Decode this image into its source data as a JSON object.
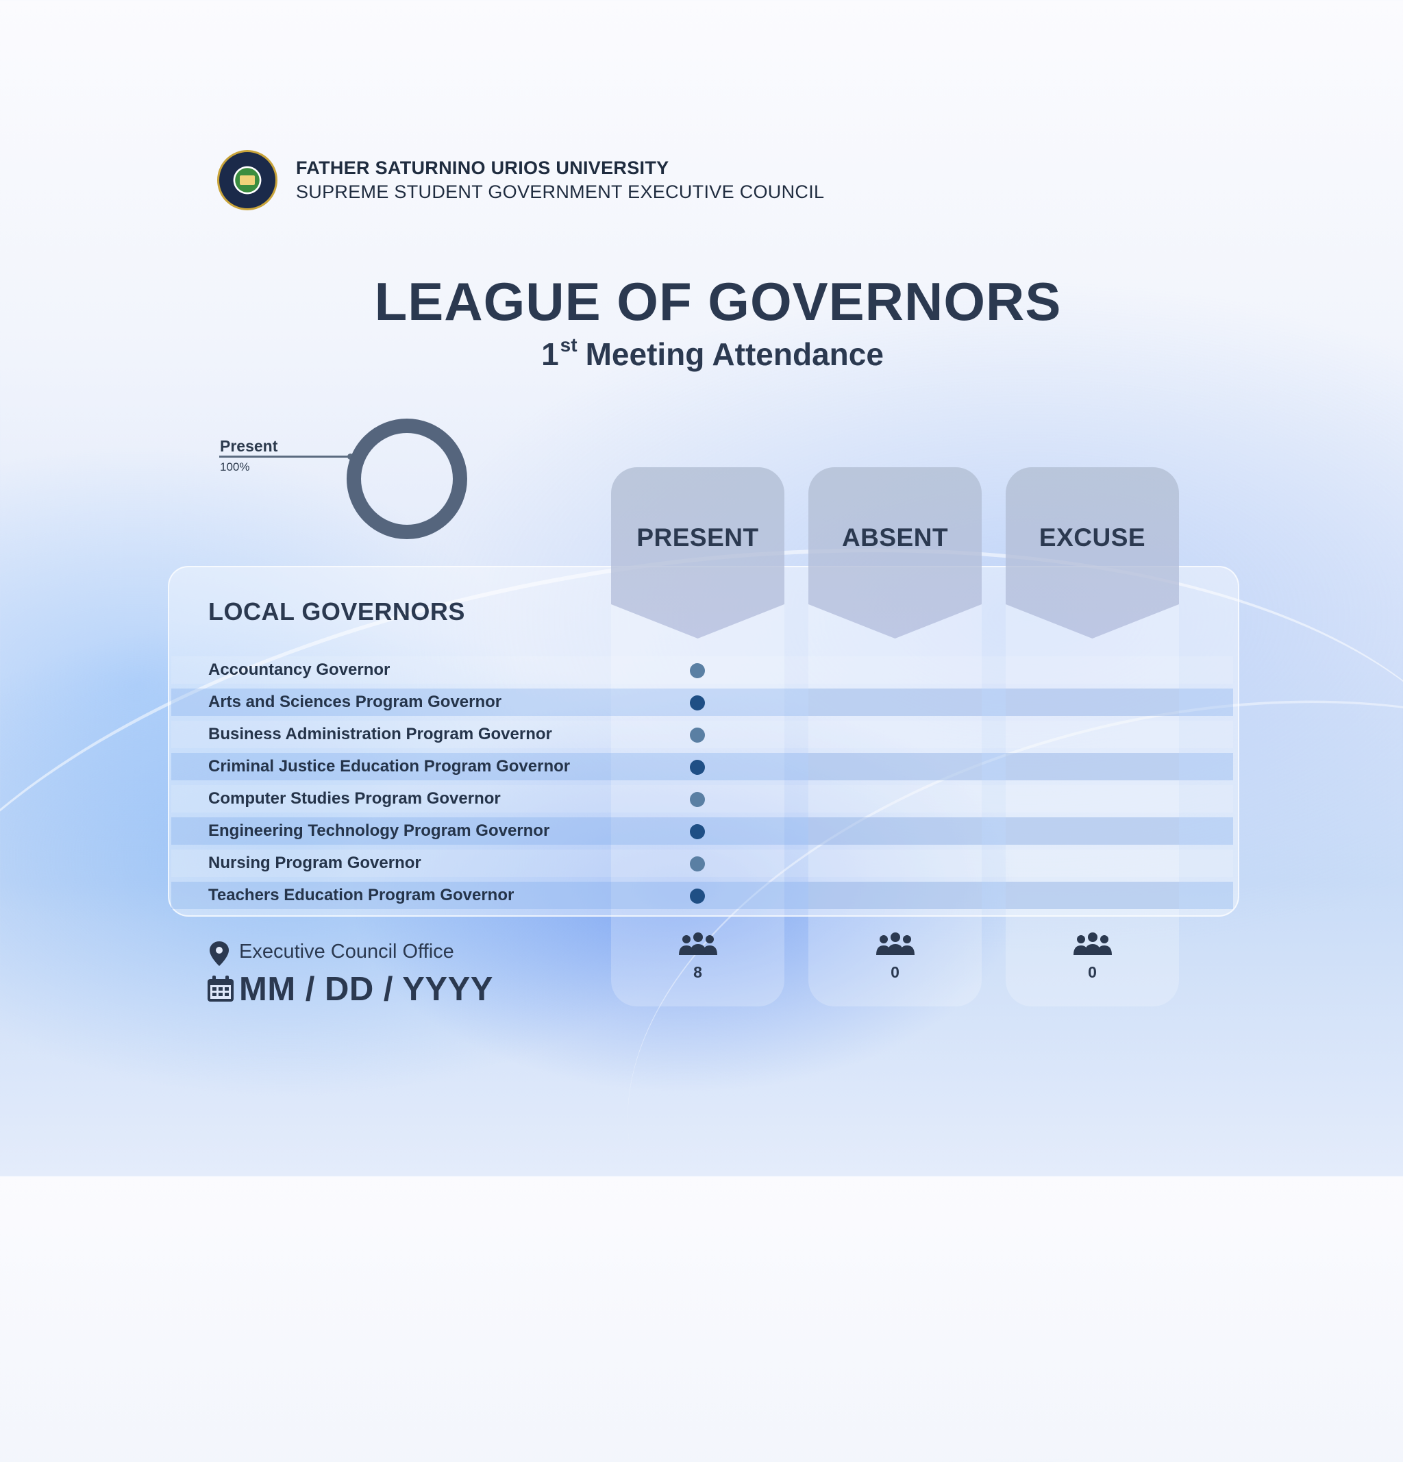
{
  "header": {
    "university": "FATHER SATURNINO URIOS UNIVERSITY",
    "council": "SUPREME STUDENT GOVERNMENT EXECUTIVE COUNCIL",
    "logo_icon": "university-seal-icon"
  },
  "title": "LEAGUE OF GOVERNORS",
  "subtitle": {
    "ordinal_number": "1",
    "ordinal_suffix": "st",
    "text": "Meeting Attendance"
  },
  "donut": {
    "label": "Present",
    "percent_label": "100%",
    "present_fraction": 1.0,
    "color": "#55657d"
  },
  "section_title": "LOCAL GOVERNORS",
  "columns": [
    "PRESENT",
    "ABSENT",
    "EXCUSE"
  ],
  "governors": [
    {
      "name": "Accountancy Governor",
      "status": "present"
    },
    {
      "name": "Arts and Sciences Program Governor",
      "status": "present"
    },
    {
      "name": "Business Administration Program Governor",
      "status": "present"
    },
    {
      "name": "Criminal Justice Education Program Governor",
      "status": "present"
    },
    {
      "name": "Computer Studies Program Governor",
      "status": "present"
    },
    {
      "name": "Engineering Technology Program  Governor",
      "status": "present"
    },
    {
      "name": "Nursing Program Governor",
      "status": "present"
    },
    {
      "name": "Teachers Education Program Governor",
      "status": "present"
    }
  ],
  "counts": {
    "present": "8",
    "absent": "0",
    "excuse": "0",
    "icon": "people-group-icon"
  },
  "footer": {
    "location": "Executive Council Office",
    "location_icon": "map-pin-icon",
    "date": "MM / DD / YYYY",
    "date_icon": "calendar-icon"
  },
  "colors": {
    "text_dark": "#2b3950",
    "mark_light": "#5a7fa3",
    "mark_dark": "#1f4f85"
  }
}
